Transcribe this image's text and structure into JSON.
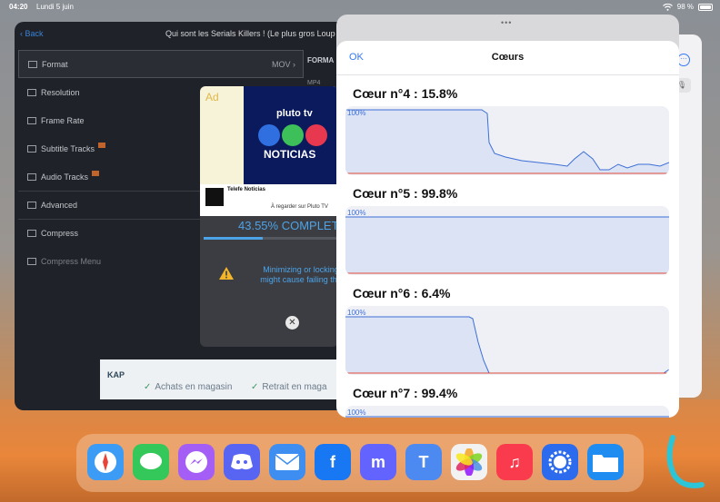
{
  "status_bar": {
    "time": "04:20",
    "date": "Lundi 5 juin",
    "battery": "98 %"
  },
  "converter": {
    "back_label": "Back",
    "title": "Qui sont les Serials Killers ! (Le plus gros Loup",
    "rows": [
      {
        "label": "Format",
        "value": "MOV ›"
      },
      {
        "label": "Resolution"
      },
      {
        "label": "Frame Rate"
      },
      {
        "label": "Subtitle Tracks"
      },
      {
        "label": "Audio Tracks"
      },
      {
        "label": "Advanced"
      },
      {
        "label": "Compress"
      },
      {
        "label": "Compress Menu"
      }
    ],
    "format_header": "FORMA",
    "format_sub": "MP4",
    "progress": {
      "text": "43.55% COMPLETE",
      "fraction": 0.4355,
      "warning_line1": "Minimizing or locking",
      "warning_line2": "might cause failing the"
    },
    "ad": {
      "label": "Ad",
      "brand": "pluto tv",
      "headline": "NOTICIAS",
      "channel": "Telefe Noticias",
      "cta": "À regarder sur Pluto TV"
    },
    "banner": {
      "logo": "KAP",
      "item1": "Achats en magasin",
      "item2": "Retrait en maga"
    }
  },
  "sheet": {
    "ok_label": "OK",
    "title": "Cœurs",
    "percent_label": "100%",
    "cores": [
      {
        "title": "Cœur n°4 : 15.8%",
        "usage": 15.8
      },
      {
        "title": "Cœur n°5 : 99.8%",
        "usage": 99.8
      },
      {
        "title": "Cœur n°6 : 6.4%",
        "usage": 6.4
      },
      {
        "title": "Cœur n°7 : 99.4%",
        "usage": 99.4
      }
    ]
  },
  "dock": {
    "apps": [
      {
        "name": "Safari",
        "color": "#3b9bf5"
      },
      {
        "name": "Messages",
        "color": "#34c759"
      },
      {
        "name": "Messenger",
        "color": "#a45ef5"
      },
      {
        "name": "Discord",
        "color": "#5865f2"
      },
      {
        "name": "Mail",
        "color": "#3d8ef0"
      },
      {
        "name": "Facebook",
        "color": "#1877f2"
      },
      {
        "name": "Mastodon",
        "color": "#6364ff"
      },
      {
        "name": "Tweetbot",
        "color": "#4c8af1"
      },
      {
        "name": "Photos",
        "color": "#f2f2f2"
      },
      {
        "name": "Music",
        "color": "#fa3b4e"
      },
      {
        "name": "Signal",
        "color": "#2c6bed"
      },
      {
        "name": "Files",
        "color": "#1e8cf0"
      }
    ]
  },
  "colors": {
    "accent": "#3478f6",
    "progress": "#4da3e8",
    "chart_line": "#3d6fd6",
    "chart_baseline": "#e04a3a"
  }
}
